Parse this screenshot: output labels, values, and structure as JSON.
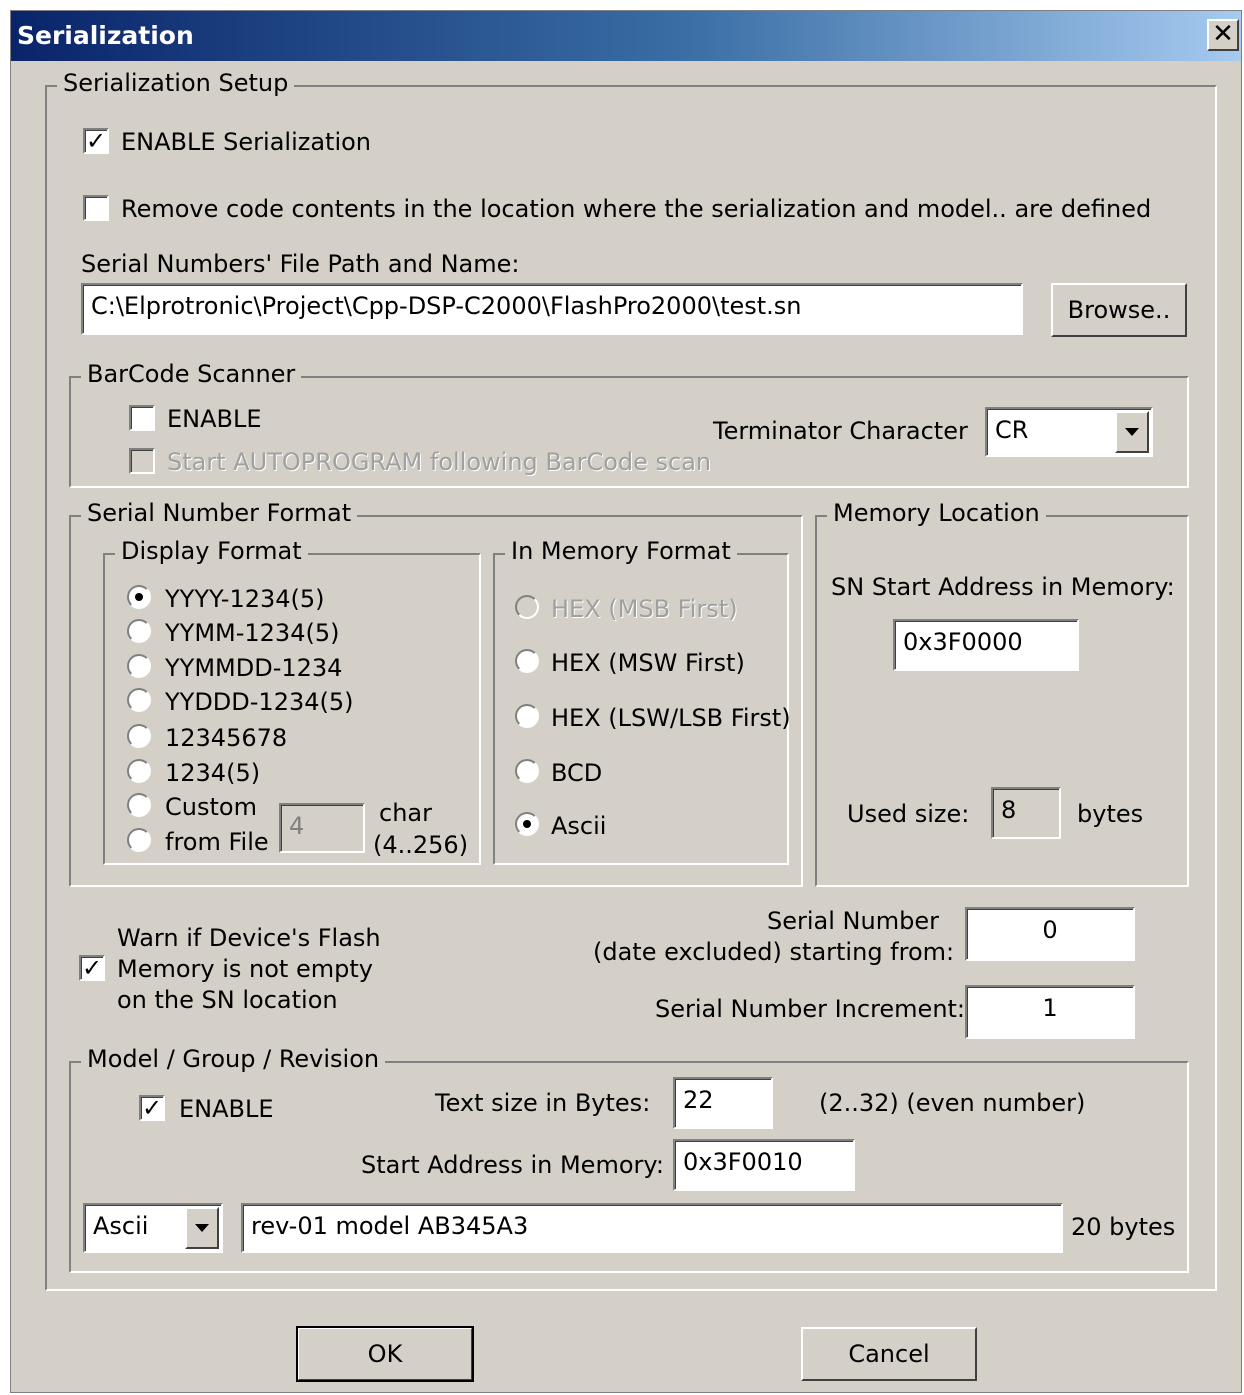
{
  "window": {
    "title": "Serialization",
    "close_label": "✕"
  },
  "setup": {
    "legend": "Serialization Setup",
    "enable_label": "ENABLE Serialization",
    "enable_checked": true,
    "remove_label": "Remove code contents in the location where the serialization and model.. are defined",
    "remove_checked": false,
    "file_label": "Serial Numbers'  File Path and Name:",
    "file_path": "C:\\Elprotronic\\Project\\Cpp-DSP-C2000\\FlashPro2000\\test.sn",
    "browse_label": "Browse.."
  },
  "barcode": {
    "legend": "BarCode Scanner",
    "enable_label": "ENABLE",
    "autoprogram_label": "Start AUTOPROGRAM following BarCode scan",
    "terminator_label": "Terminator Character",
    "terminator_value": "CR"
  },
  "format": {
    "legend": "Serial Number Format",
    "display_legend": "Display Format",
    "display_options": [
      "YYYY-1234(5)",
      "YYMM-1234(5)",
      "YYMMDD-1234",
      "YYDDD-1234(5)",
      "12345678",
      "1234(5)",
      "Custom",
      "from File"
    ],
    "display_selected": "YYYY-1234(5)",
    "custom_value": "4",
    "char_label": "char",
    "char_range": "(4..256)",
    "memory_legend": "In Memory Format",
    "memory_options": [
      "HEX (MSB First)",
      "HEX (MSW First)",
      "HEX (LSW/LSB First)",
      "BCD",
      "Ascii"
    ],
    "memory_selected": "Ascii"
  },
  "location": {
    "legend": "Memory Location",
    "start_label": "SN Start Address in Memory:",
    "start_value": "0x3F0000",
    "used_label": "Used size:",
    "used_value": "8",
    "used_unit": "bytes"
  },
  "warn": {
    "line1": "Warn if Device's Flash",
    "line2": "Memory is not empty",
    "line3": "on the SN location",
    "checked": true
  },
  "serial": {
    "label_line1": "Serial Number",
    "label_line2": "(date excluded) starting  from:",
    "start_value": "0",
    "increment_label": "Serial Number Increment:",
    "increment_value": "1"
  },
  "model": {
    "legend": "Model / Group / Revision",
    "enable_label": "ENABLE",
    "enable_checked": true,
    "text_size_label": "Text size in Bytes:",
    "text_size_value": "22",
    "text_size_hint": "(2..32) (even number)",
    "start_label": "Start Address in Memory:",
    "start_value": "0x3F0010",
    "encoding_value": "Ascii",
    "text_value": "rev-01 model AB345A3",
    "bytes_label": "20 bytes"
  },
  "buttons": {
    "ok": "OK",
    "cancel": "Cancel"
  }
}
